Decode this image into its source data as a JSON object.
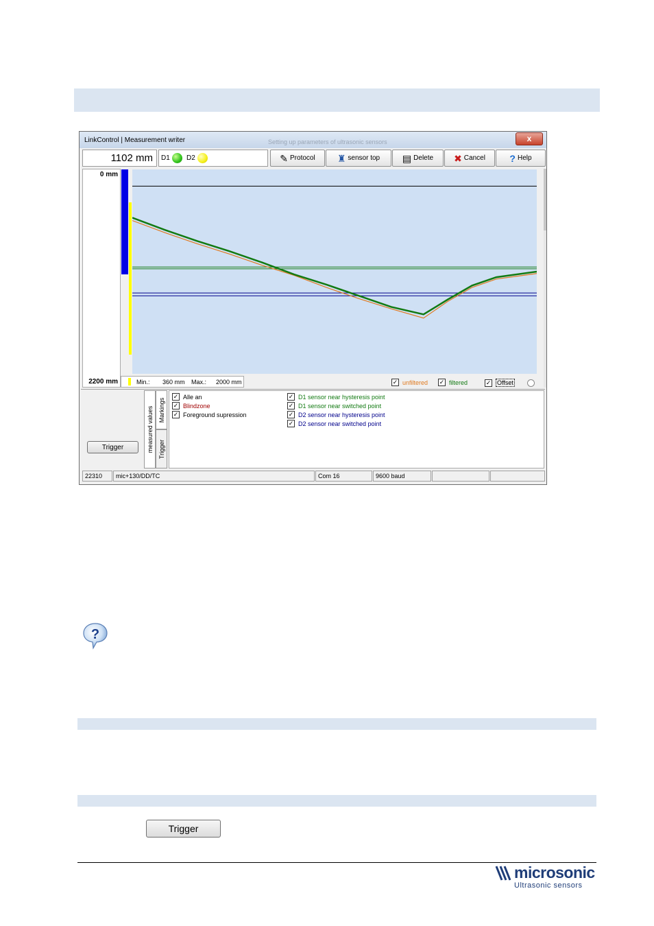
{
  "window": {
    "title": "LinkControl | Measurement writer",
    "title_ghost": "Setting up parameters of ultrasonic sensors",
    "close_glyph": "x"
  },
  "toolbar": {
    "reading": "1102 mm",
    "d1_label": "D1",
    "d2_label": "D2",
    "buttons": {
      "protocol": "Protocol",
      "sensor_top": "sensor top",
      "delete": "Delete",
      "cancel": "Cancel",
      "help": "Help"
    }
  },
  "chart": {
    "y_top_label": "0 mm",
    "y_bottom_label": "2200 mm",
    "min_label": "Min.:",
    "min_value": "360 mm",
    "max_label": "Max.:",
    "max_value": "2000 mm",
    "legend": {
      "unfiltered": "unfiltered",
      "filtered": "filtered",
      "offset": "Offset"
    },
    "colors": {
      "unfiltered": "#e07a1f",
      "filtered": "#127a12",
      "plot_bg": "#cfe0f4",
      "bar_blue": "#0000e6",
      "bar_yellow": "#ffff00"
    }
  },
  "chart_data": {
    "type": "line",
    "ylim": [
      0,
      2200
    ],
    "y_inverted": true,
    "series": [
      {
        "name": "filtered",
        "x": [
          0,
          8,
          16,
          24,
          32,
          40,
          48,
          56,
          64,
          72,
          78,
          84,
          90,
          100
        ],
        "y": [
          520,
          650,
          770,
          880,
          1000,
          1130,
          1240,
          1360,
          1480,
          1560,
          1400,
          1250,
          1160,
          1100
        ]
      },
      {
        "name": "unfiltered",
        "x": [
          0,
          8,
          16,
          24,
          32,
          40,
          48,
          56,
          64,
          72,
          78,
          84,
          90,
          100
        ],
        "y": [
          550,
          680,
          800,
          910,
          1030,
          1140,
          1270,
          1390,
          1500,
          1600,
          1420,
          1270,
          1180,
          1120
        ]
      }
    ],
    "markers": [
      {
        "value": 180,
        "color": "#000000"
      },
      {
        "value": 1050,
        "color": "#127a12"
      },
      {
        "value": 1070,
        "color": "#127a12"
      },
      {
        "value": 1330,
        "color": "#00008b"
      },
      {
        "value": 1360,
        "color": "#00008b"
      }
    ]
  },
  "trigger_button": "Trigger",
  "tabs": {
    "measured": "measured values",
    "markings": "Markings",
    "trigger": "Trigger"
  },
  "options_left": [
    {
      "label": "Alle an",
      "color": "#000000"
    },
    {
      "label": "Blindzone",
      "color": "#a00000"
    },
    {
      "label": "Foreground supression",
      "color": "#000000"
    }
  ],
  "options_right": [
    {
      "label": "D1 sensor near hysteresis point",
      "color": "#127a12"
    },
    {
      "label": "D1 sensor near switched point",
      "color": "#127a12"
    },
    {
      "label": "D2 sensor near hysteresis point",
      "color": "#00008b"
    },
    {
      "label": "D2 sensor near switched point",
      "color": "#00008b"
    }
  ],
  "statusbar": {
    "id": "22310",
    "sensor": "mic+130/DD/TC",
    "port": "Com 16",
    "baud": "9600 baud"
  },
  "page": {
    "trigger_label": "Trigger",
    "logo_name": "microsonic",
    "logo_tagline": "Ultrasonic sensors"
  }
}
